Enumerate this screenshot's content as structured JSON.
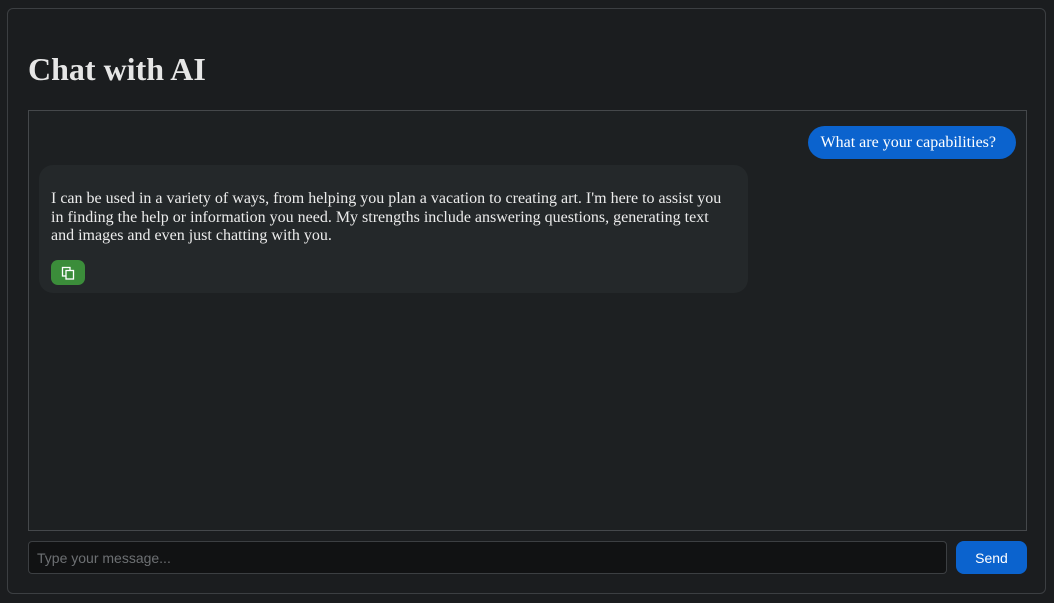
{
  "header": {
    "title": "Chat with AI"
  },
  "messages": [
    {
      "role": "user",
      "text": "What are your capabilities?"
    },
    {
      "role": "assistant",
      "text": "I can be used in a variety of ways, from helping you plan a vacation to creating art. I'm here to assist you in finding the help or information you need. My strengths include answering questions, generating text and images and even just chatting with you.",
      "action_icon": "copy-icon"
    }
  ],
  "composer": {
    "placeholder": "Type your message...",
    "value": "",
    "send_label": "Send"
  },
  "colors": {
    "background": "#1b1d1f",
    "user_bubble": "#0b63ce",
    "assistant_bubble": "#24282a",
    "copy_button": "#3b8d3a",
    "send_button": "#0b63ce"
  }
}
